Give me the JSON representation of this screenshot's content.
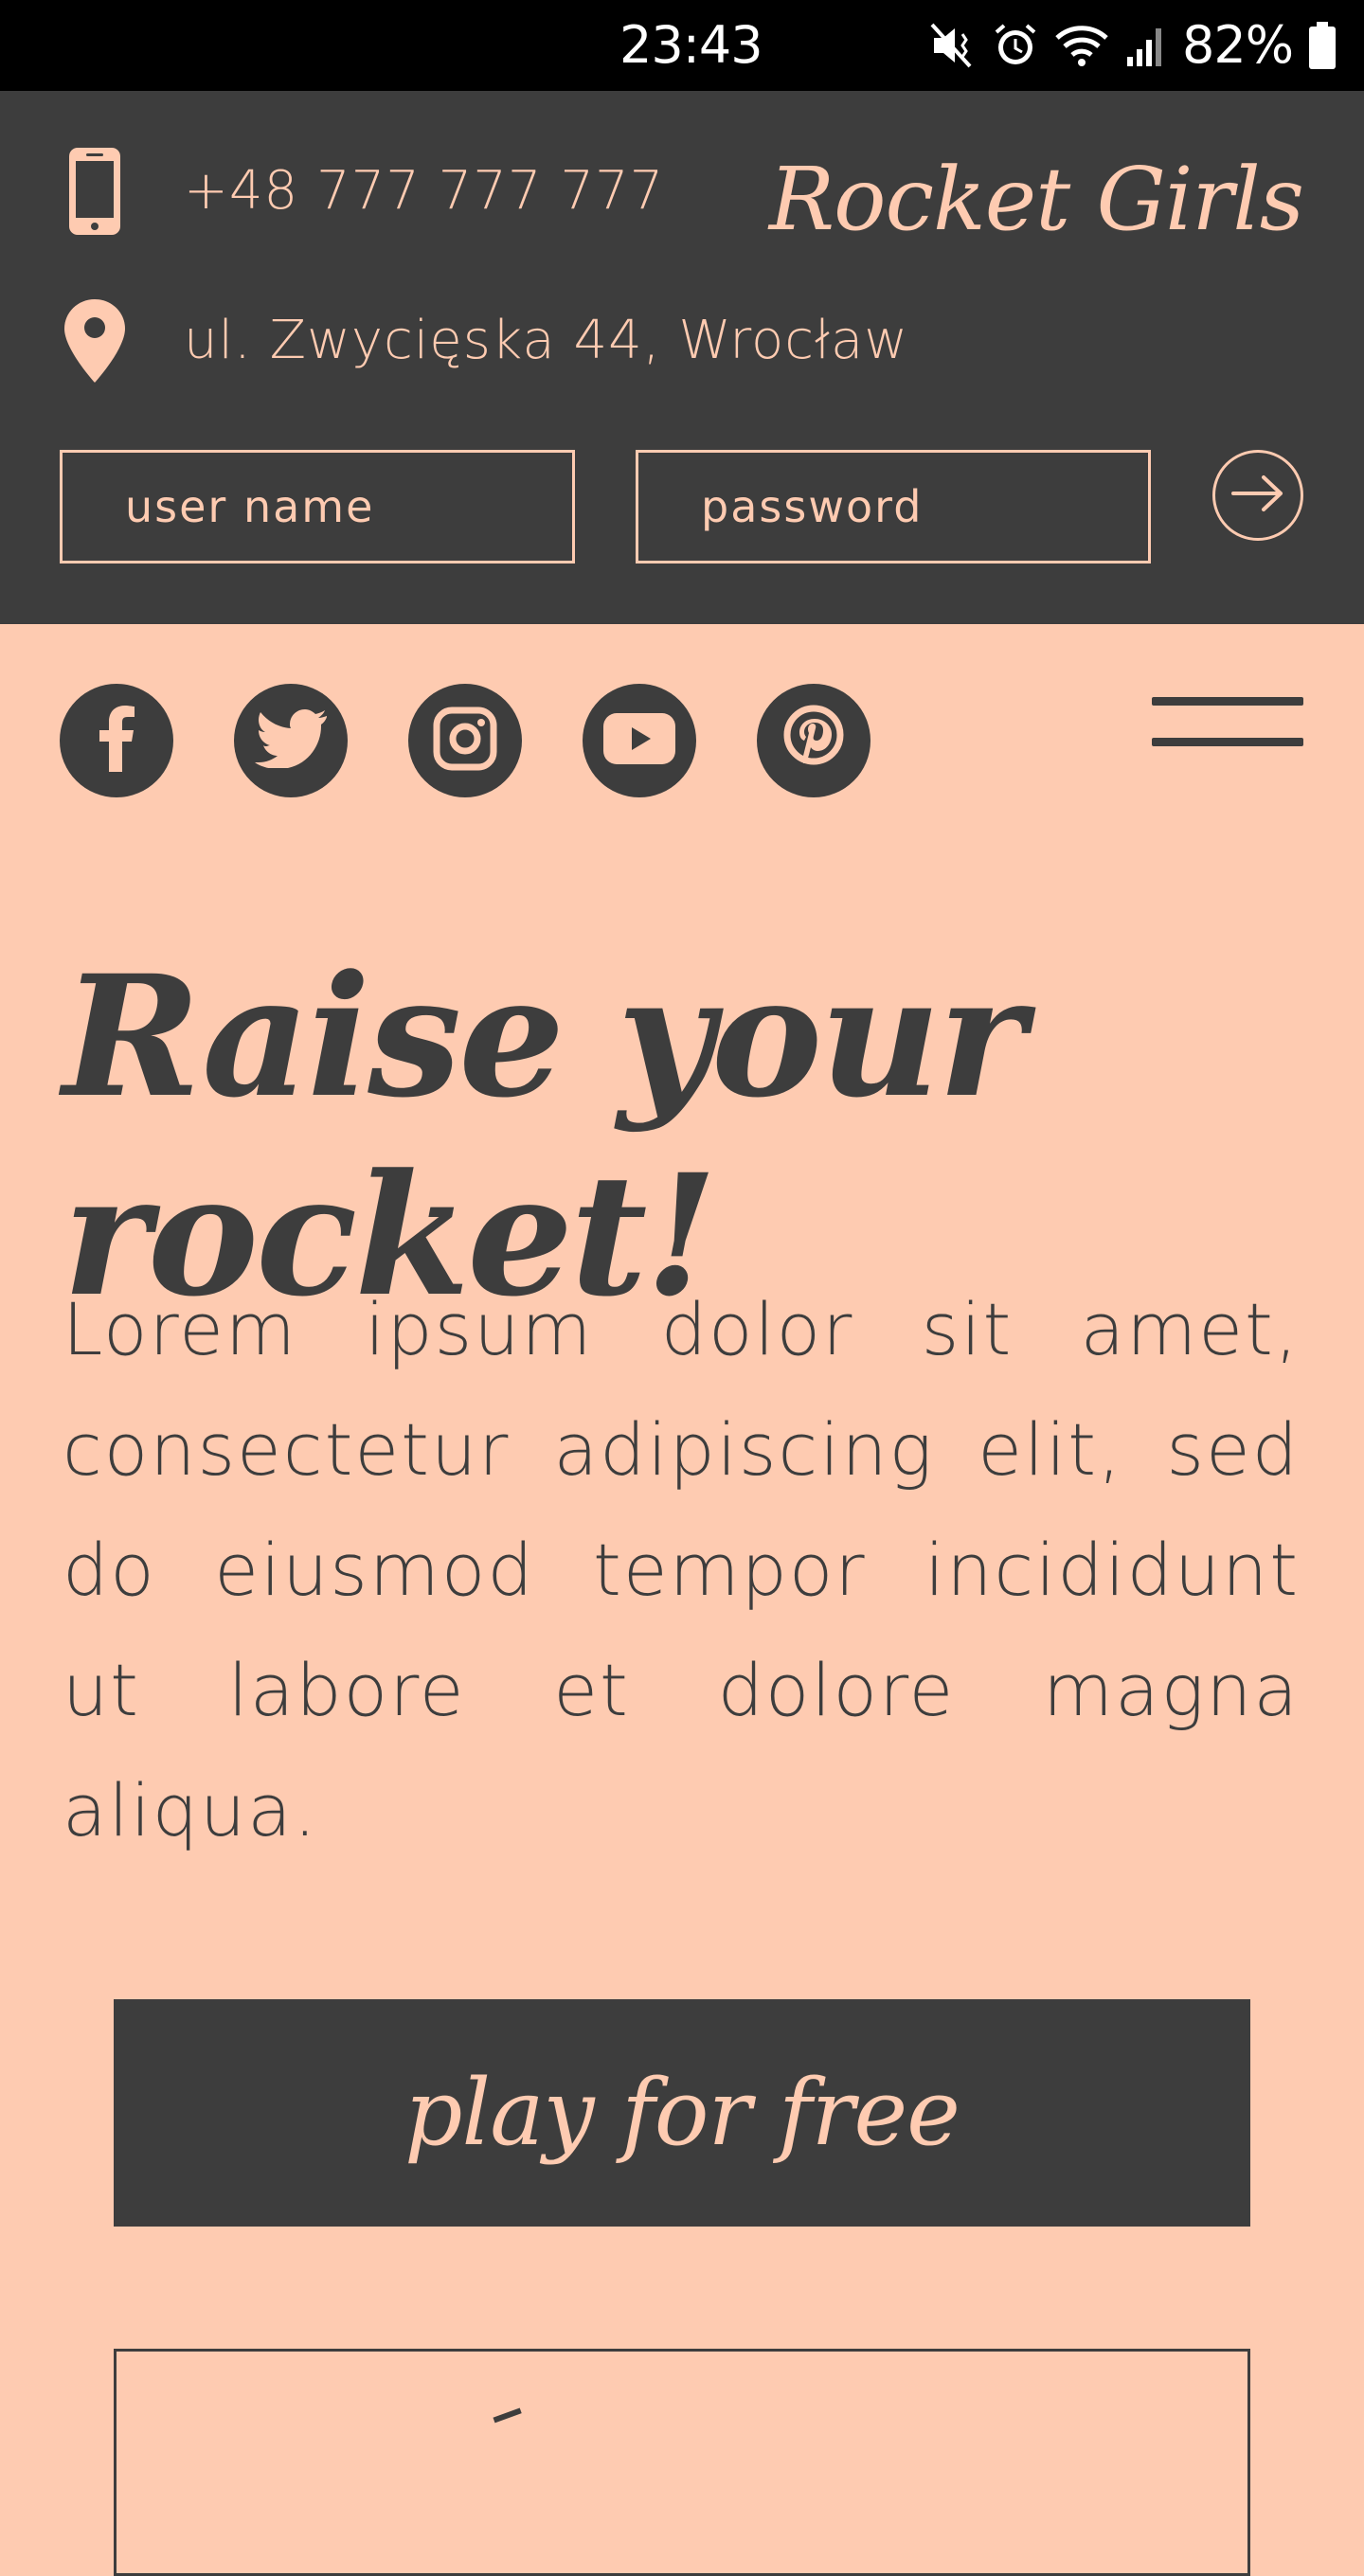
{
  "status_bar": {
    "time": "23:43",
    "battery_percent": "82%",
    "icons": [
      "mute-icon",
      "alarm-icon",
      "wifi-icon",
      "signal-icon",
      "battery-icon"
    ]
  },
  "header": {
    "phone": "+48 777 777 777",
    "address": "ul. Zwycięska 44, Wrocław",
    "brand": "Rocket Girls",
    "login": {
      "username_placeholder": "user name",
      "password_placeholder": "password"
    }
  },
  "social": [
    "facebook-icon",
    "twitter-icon",
    "instagram-icon",
    "youtube-icon",
    "pinterest-icon"
  ],
  "hero": {
    "headline": "Raise your rocket!",
    "body": "Lorem ipsum dolor sit amet, consectetur adipiscing elit, sed do eiusmod tempor incididunt ut labore et dolore magna aliqua.",
    "primary_button": "play for free"
  },
  "colors": {
    "peach": "#fecbb1",
    "charcoal": "#3d3d3d"
  }
}
